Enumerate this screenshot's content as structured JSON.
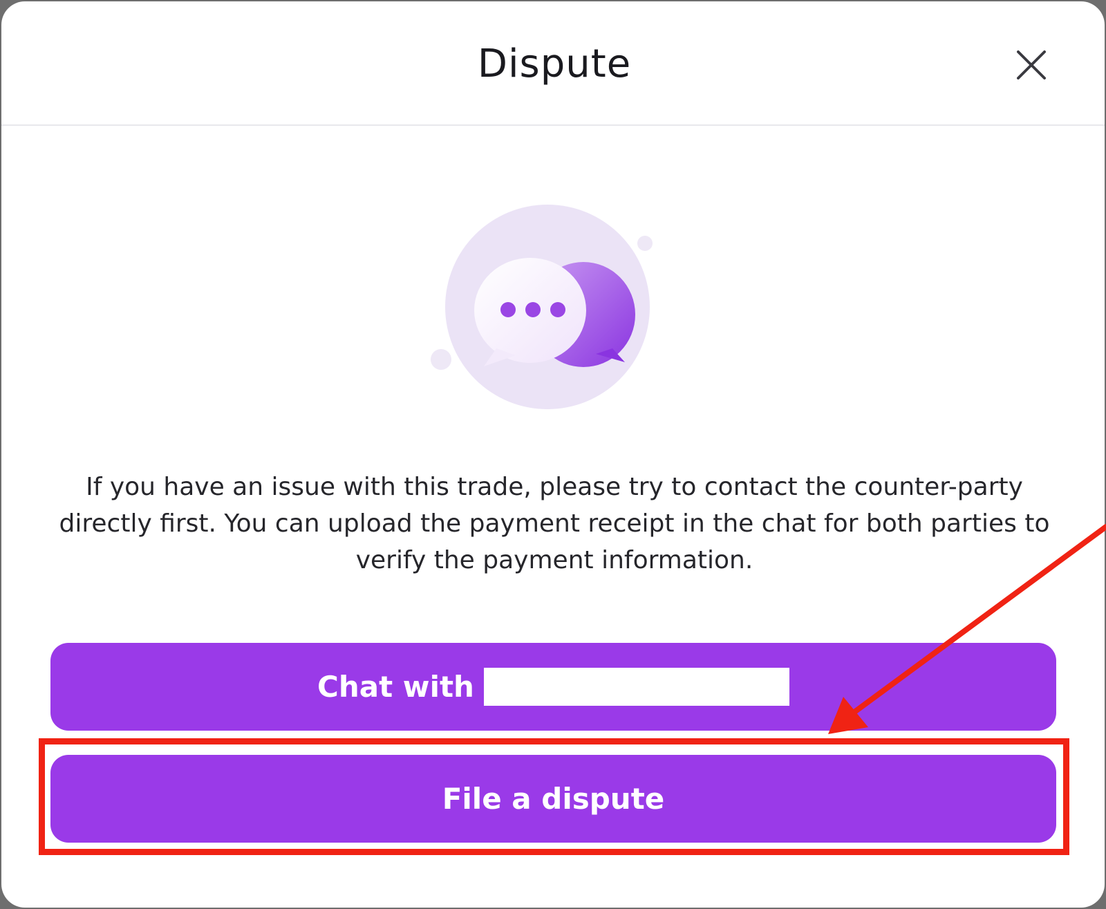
{
  "dialog": {
    "title": "Dispute",
    "close_icon": "close-icon",
    "illustration_icon": "chat-bubbles-icon",
    "message": "If you have an issue with this trade, please try to contact the counter-party directly first. You can upload the payment receipt in the chat for both parties to verify the payment information.",
    "buttons": {
      "chat_label": "Chat with",
      "dispute_label": "File a dispute"
    }
  },
  "colors": {
    "accent": "#9a3ae8",
    "annotation": "#f02314",
    "overlay": "#6e6e6e"
  }
}
